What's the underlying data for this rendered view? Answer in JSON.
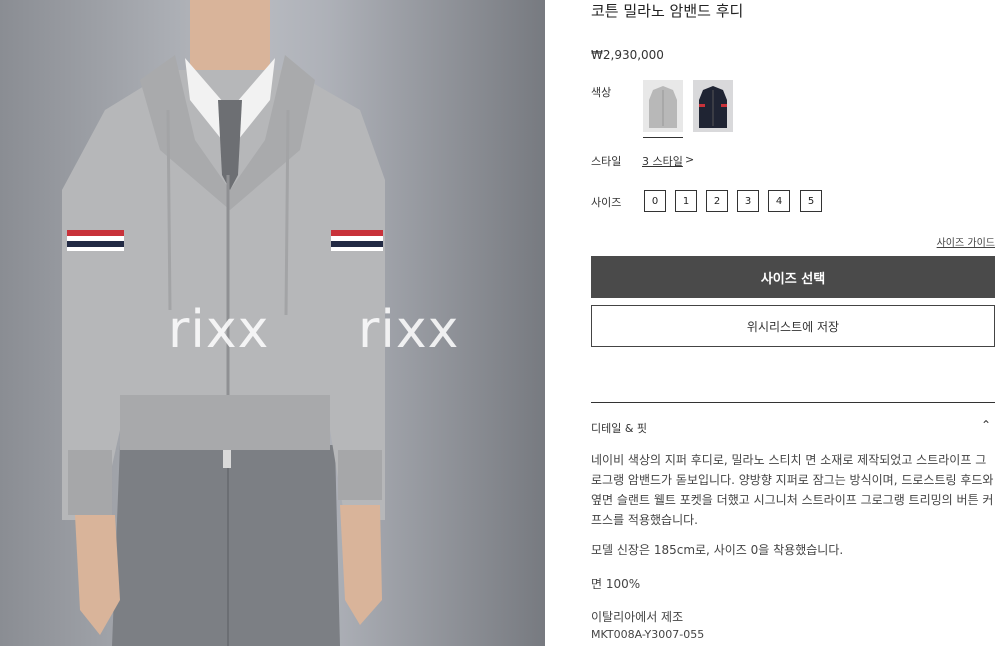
{
  "product": {
    "title": "코튼 밀라노 암밴드 후디",
    "price": "₩2,930,000"
  },
  "image": {
    "watermarks": [
      "rixx",
      "rixx"
    ]
  },
  "options": {
    "color_label": "색상",
    "colors": [
      {
        "name": "grey",
        "hex": "#b5b5b5",
        "selected": true
      },
      {
        "name": "navy",
        "hex": "#1f2433",
        "selected": false
      }
    ],
    "style_label": "스타일",
    "style_link": "3 스타일",
    "style_arrow": ">",
    "size_label": "사이즈",
    "sizes": [
      "0",
      "1",
      "2",
      "3",
      "4",
      "5"
    ],
    "size_guide": "사이즈 가이드"
  },
  "actions": {
    "select_size": "사이즈 선택",
    "wishlist": "위시리스트에 저장"
  },
  "details": {
    "heading": "디테일 & 핏",
    "chevron": "⌃",
    "description": "네이비 색상의 지퍼 후디로, 밀라노 스티치 면 소재로 제작되었고 스트라이프 그로그랭 암밴드가 돋보입니다. 양방향 지퍼로 잠그는 방식이며, 드로스트링 후드와 옆면 슬랜트 웰트 포켓을 더했고 시그니처 스트라이프 그로그랭 트리밍의 버튼 커프스를 적용했습니다.",
    "model": "모델 신장은 185cm로, 사이즈 0을 착용했습니다.",
    "material": "면 100%",
    "origin": "이탈리아에서 제조",
    "sku": "MKT008A-Y3007-055"
  }
}
